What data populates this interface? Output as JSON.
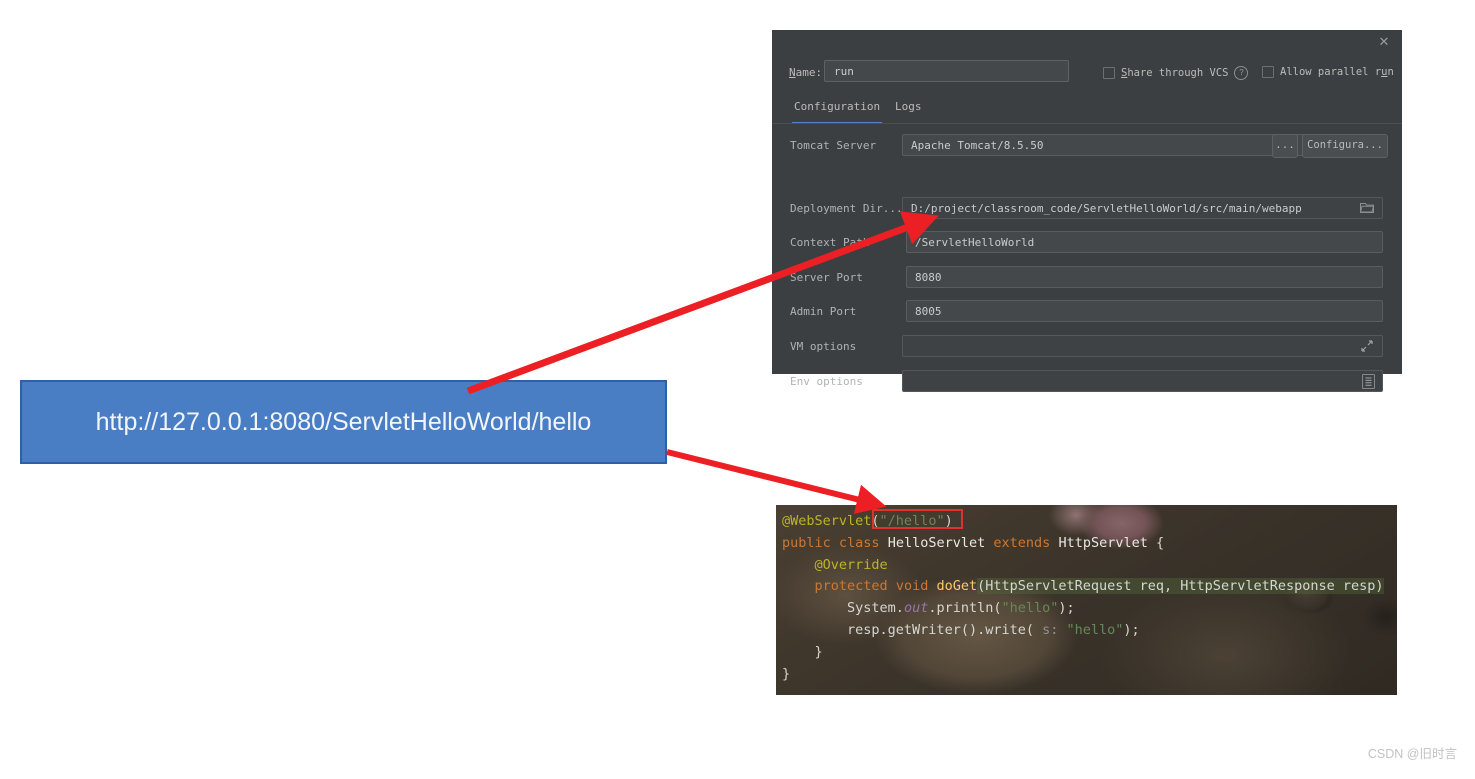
{
  "dialog": {
    "close_icon": "close-icon",
    "name_label_prefix": "N",
    "name_label_rest": "ame:",
    "name_value": "run",
    "name_placeholder": "Name",
    "share_vcs": {
      "mnemonic": "S",
      "rest": "hare through VCS",
      "help_icon": "?"
    },
    "allow_parallel": {
      "prefix": "Allow parallel r",
      "mnemonic": "u",
      "suffix": "n"
    },
    "tabs": [
      {
        "label": "Configuration",
        "active": true
      },
      {
        "label": "Logs",
        "active": false
      }
    ],
    "fields": {
      "tomcat_server": {
        "label": "Tomcat Server",
        "value": "Apache Tomcat/8.5.50",
        "dropdown_icon": "chevron-down-icon",
        "ellipsis_button": "...",
        "configure_button": "Configura..."
      },
      "deployment_dir": {
        "label": "Deployment Dir...",
        "value": "D:/project/classroom_code/ServletHelloWorld/src/main/webapp",
        "browse_icon": "folder-icon"
      },
      "context_path": {
        "label": "Context Path",
        "value": "/ServletHelloWorld"
      },
      "server_port": {
        "label": "Server Port",
        "value": "8080"
      },
      "admin_port": {
        "label": "Admin Port",
        "value": "8005"
      },
      "vm_options": {
        "label": "VM options",
        "value": "",
        "expand_icon": "expand-icon"
      },
      "env_options": {
        "label": "Env options",
        "value": "",
        "list_icon": "list-icon"
      }
    },
    "accent_color": "#4a88c7",
    "background_color": "#3c3f41"
  },
  "callout": {
    "url": "http://127.0.0.1:8080/ServletHelloWorld/hello",
    "fill_color": "#4a7ec4",
    "border_color": "#2f5fa5",
    "text_color": "#f2f5f8"
  },
  "code": {
    "lines": [
      "@WebServlet(\"/hello\")",
      "public class HelloServlet extends HttpServlet {",
      "    @Override",
      "    protected void doGet(HttpServletRequest req, HttpServletResponse resp)",
      "        System.out.println(\"hello\");",
      "        resp.getWriter().write( s: \"hello\");",
      "    }",
      "}"
    ],
    "tokens": {
      "annotation_webservlet": "@WebServlet",
      "paren_open": "(",
      "string_hello_path": "\"/hello\"",
      "paren_close": ")",
      "kw_public": "public",
      "kw_class": "class",
      "cls_helloservlet": "HelloServlet",
      "kw_extends": "extends",
      "cls_httpservlet": "HttpServlet",
      "brace_open": "{",
      "annotation_override": "@Override",
      "kw_protected": "protected",
      "kw_void": "void",
      "mth_doget": "doGet",
      "param_sig": "(HttpServletRequest req, HttpServletResponse resp)",
      "sys_system": "System.",
      "field_out": "out",
      "mth_println": ".println(",
      "string_hello": "\"hello\"",
      "semi_close": ");",
      "resp_call": "resp.getWriter().write(",
      "hint_s": " s: ",
      "brace_close_inner": "    }",
      "brace_close_outer": "}"
    },
    "highlight_box": "red-highlight-hello"
  },
  "annotations": {
    "arrow_1_name": "arrow-to-context-path",
    "arrow_2_name": "arrow-to-webservlet-path",
    "arrow_color": "#ec2024"
  },
  "watermark": {
    "text": "CSDN @旧时言"
  }
}
